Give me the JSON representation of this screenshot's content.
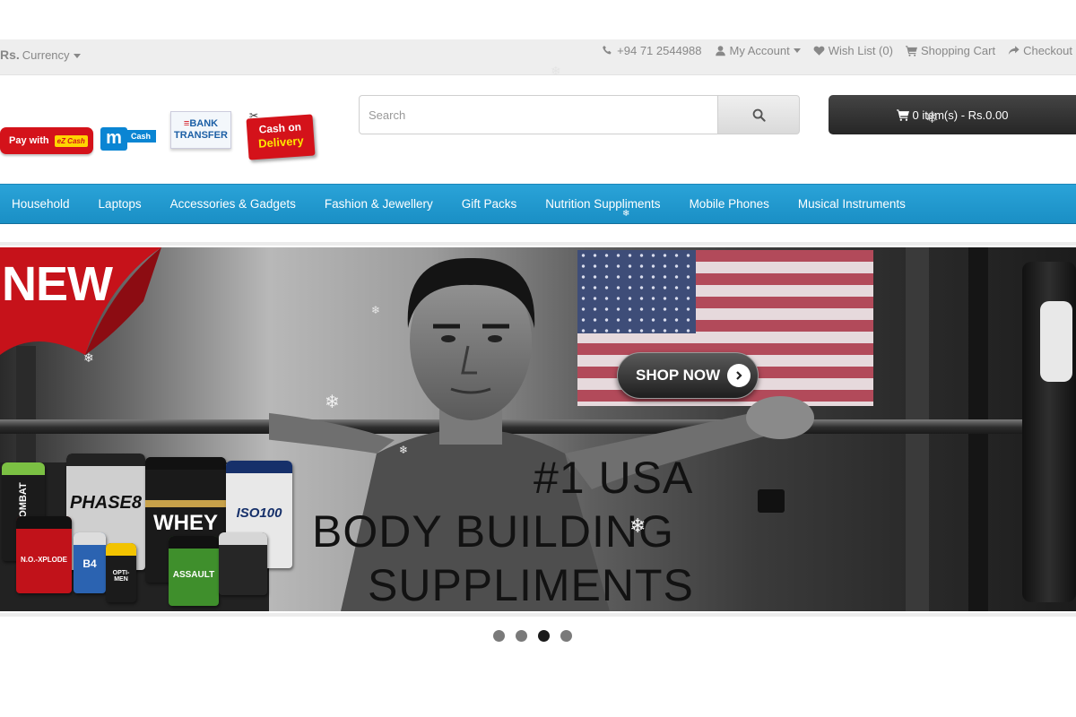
{
  "topbar": {
    "currency_symbol": "Rs.",
    "currency_label": "Currency",
    "phone": "+94 71 2544988",
    "my_account": "My Account",
    "wish_list": "Wish List (0)",
    "shopping_cart": "Shopping Cart",
    "checkout": "Checkout"
  },
  "payments": {
    "ezcash_label": "Pay with",
    "ezcash_brand": "eZ Cash",
    "mcash_m": "m",
    "mcash_label": "Cash",
    "bank_line1": "BANK",
    "bank_line2": "TRANSFER",
    "cod_line1": "Cash on",
    "cod_line2": "Delivery"
  },
  "search": {
    "placeholder": "Search"
  },
  "cart": {
    "summary": "0 item(s) - Rs.0.00"
  },
  "menu": {
    "items": [
      "Household",
      "Laptops",
      "Accessories & Gadgets",
      "Fashion & Jewellery",
      "Gift Packs",
      "Nutrition Suppliments",
      "Mobile Phones",
      "Musical Instruments"
    ]
  },
  "banner": {
    "corner_label": "NEW",
    "shop_now": "SHOP NOW",
    "headline_1": "#1 USA",
    "headline_2": "BODY BUILDING",
    "headline_3": "SUPPLIMENTS",
    "products": [
      "COMBAT",
      "PHASE8",
      "WHEY",
      "ISO100",
      "N.O.-XPLODE",
      "B4",
      "OPTI-MEN",
      "ASSAULT"
    ]
  },
  "slider": {
    "dots": 4,
    "active_index": 2
  },
  "colors": {
    "menu_bar": "#1f97cd",
    "cart_button": "#2f2f2f",
    "topbar_bg": "#eeeeee",
    "badge_red": "#d4121a"
  }
}
